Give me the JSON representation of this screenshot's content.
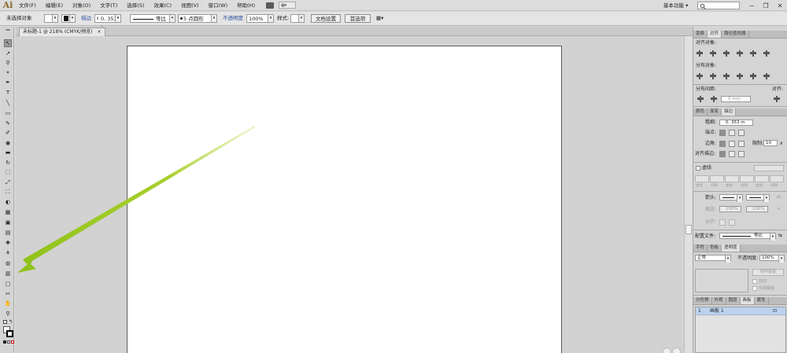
{
  "app": {
    "logo": "Ai",
    "menus": [
      "文件(F)",
      "编辑(E)",
      "对象(O)",
      "文字(T)",
      "选择(S)",
      "效果(C)",
      "视图(V)",
      "窗口(W)",
      "帮助(H)"
    ],
    "workspace": "基本功能",
    "workspace_arrow": "▾",
    "search_icon": "search-icon",
    "window_controls": [
      "−",
      "❐",
      "✕"
    ]
  },
  "control_bar": {
    "selection_status": "未选择对象",
    "stroke_label": "描边",
    "stroke_weight": "0. 353 r",
    "profile": "等比",
    "brush": "5 点圆形",
    "opacity_label": "不透明度",
    "opacity_value": "100%",
    "style_label": "样式:",
    "doc_setup_button": "文档设置",
    "preferences_button": "首选项"
  },
  "document": {
    "tab_title": "未标题-1 @ 218% (CMYK/预览)",
    "tab_close": "×"
  },
  "tools": {
    "glyphs": [
      "↖",
      "↗",
      "⚲",
      "⌖",
      "✒",
      "T",
      "╲",
      "▭",
      "✎",
      "✐",
      "◉",
      "▬",
      "↻",
      "⬚",
      "⤢",
      "⛶",
      "◐",
      "▦",
      "▣",
      "▤",
      "✚",
      "⚘",
      "◍",
      "▥",
      "▢",
      "✂",
      "✋",
      "⚲"
    ]
  },
  "align_panel": {
    "tabs": [
      "变换",
      "对齐",
      "路径查找器"
    ],
    "align_objects": "对齐对象:",
    "distribute_objects": "分布对象:",
    "distribute_spacing": "分布间距:",
    "spacing_value": "0 mm",
    "align_to": "对齐:"
  },
  "stroke_panel": {
    "tabs": [
      "颜色",
      "渐变",
      "描边"
    ],
    "weight_label": "粗细:",
    "weight_value": "0. 353 m",
    "cap_label": "端点:",
    "corner_label": "边角:",
    "limit_label": "限制:",
    "limit_value": "10",
    "limit_suffix": "x",
    "align_stroke": "对齐描边:",
    "dashed_label": "虚线",
    "dash_fields": [
      "虚线",
      "间隙",
      "虚线",
      "间隙",
      "虚线",
      "间隙"
    ],
    "arrow_label": "箭头:",
    "scale_label": "缩放:",
    "scale_values": [
      "100%",
      "100%"
    ],
    "align_label": "对齐:",
    "profile_label": "配置文件:",
    "profile_value": "等比"
  },
  "transparency_panel": {
    "tabs": [
      "字符",
      "色板",
      "透明度"
    ],
    "blend_mode": "正常",
    "opacity_label": "不透明度:",
    "opacity_value": "100%",
    "make_mask": "制作蒙版",
    "clip": "剪切",
    "invert_mask": "反相蒙版"
  },
  "artboards_panel": {
    "tabs": [
      "分色预",
      "外观",
      "图层",
      "画板",
      "属性"
    ],
    "rows": [
      {
        "index": "1",
        "name": "画板 1"
      }
    ]
  }
}
